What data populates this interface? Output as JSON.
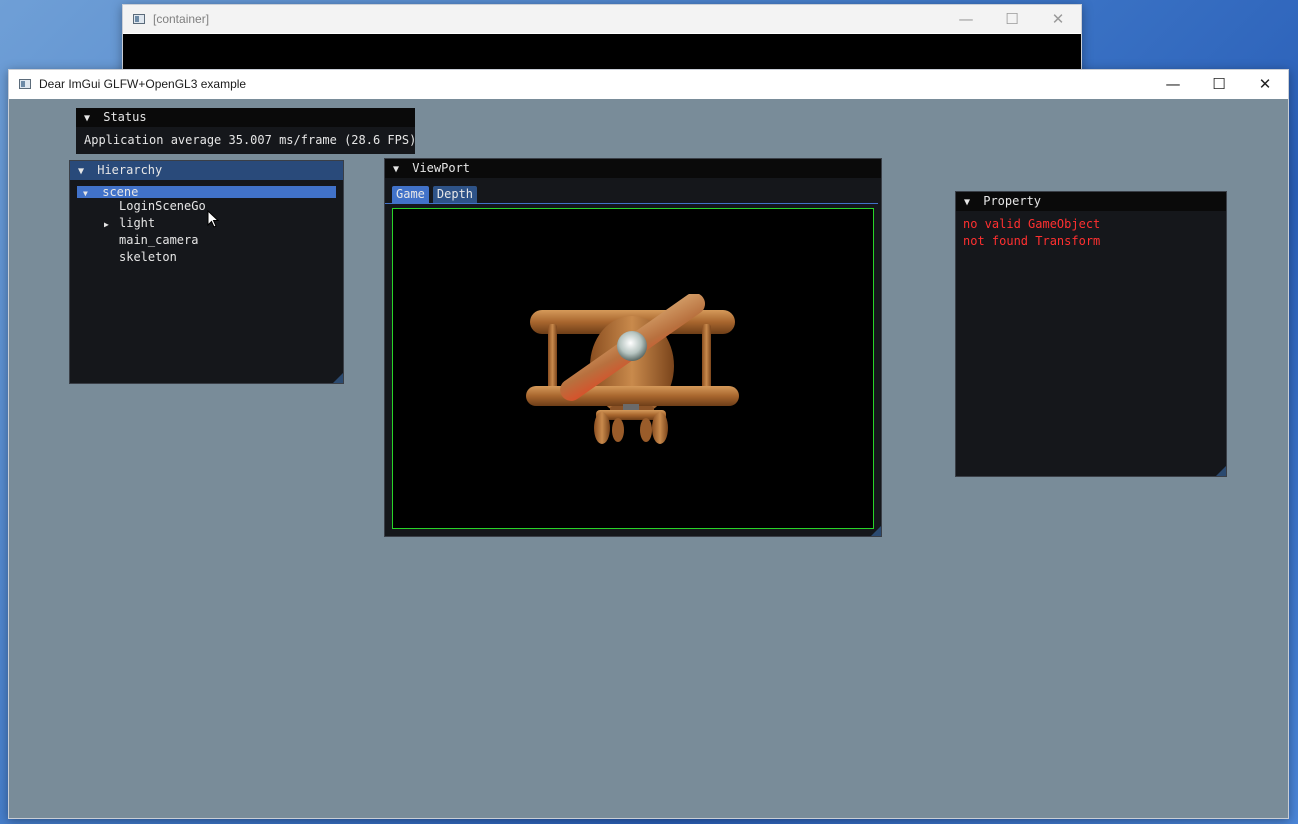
{
  "bg_window": {
    "title": "[container]",
    "controls": {
      "minimize": "—",
      "maximize": "☐",
      "close": "✕"
    }
  },
  "main_window": {
    "title": "Dear ImGui GLFW+OpenGL3 example",
    "controls": {
      "minimize": "—",
      "maximize": "☐",
      "close": "✕"
    },
    "background_color": "#798c99"
  },
  "status_panel": {
    "title": "Status",
    "text": "Application average 35.007 ms/frame (28.6 FPS)"
  },
  "hierarchy_panel": {
    "title": "Hierarchy",
    "root": "scene",
    "items": [
      {
        "label": "LoginSceneGo",
        "expandable": false
      },
      {
        "label": "light",
        "expandable": true
      },
      {
        "label": "main_camera",
        "expandable": false
      },
      {
        "label": "skeleton",
        "expandable": false
      }
    ]
  },
  "viewport_panel": {
    "title": "ViewPort",
    "tabs": [
      "Game",
      "Depth"
    ],
    "active_tab": "Game",
    "frame_color": "#28d428"
  },
  "property_panel": {
    "title": "Property",
    "messages": [
      "no valid GameObject",
      "not found Transform"
    ],
    "message_color": "#ff3030"
  },
  "icons": {
    "expanded": "▼",
    "collapsed": "▶"
  }
}
